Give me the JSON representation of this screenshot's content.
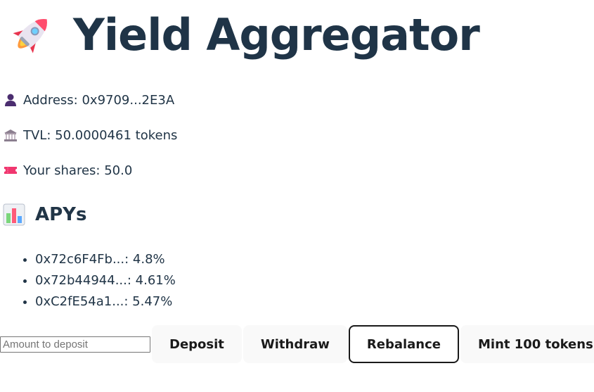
{
  "header": {
    "title": "Yield Aggregator",
    "icon": "rocket-icon"
  },
  "info": {
    "address": {
      "icon": "user-icon",
      "text": "Address: 0x9709...2E3A"
    },
    "tvl": {
      "icon": "bank-icon",
      "text": "TVL: 50.0000461 tokens"
    },
    "shares": {
      "icon": "ticket-icon",
      "text": "Your shares: 50.0"
    }
  },
  "apys": {
    "icon": "bar-chart-icon",
    "heading": "APYs",
    "items": [
      {
        "text": "0x72c6F4Fb...: 4.8%"
      },
      {
        "text": "0x72b44944...: 4.61%"
      },
      {
        "text": "0xC2fE54a1...: 5.47%"
      }
    ]
  },
  "controls": {
    "amount_placeholder": "Amount to deposit",
    "amount_value": "",
    "deposit_label": "Deposit",
    "withdraw_label": "Withdraw",
    "rebalance_label": "Rebalance",
    "mint_label": "Mint 100 tokens"
  },
  "colors": {
    "text": "#213547",
    "button_bg": "#f9f9f9",
    "focused_border": "#1a1a1a"
  }
}
